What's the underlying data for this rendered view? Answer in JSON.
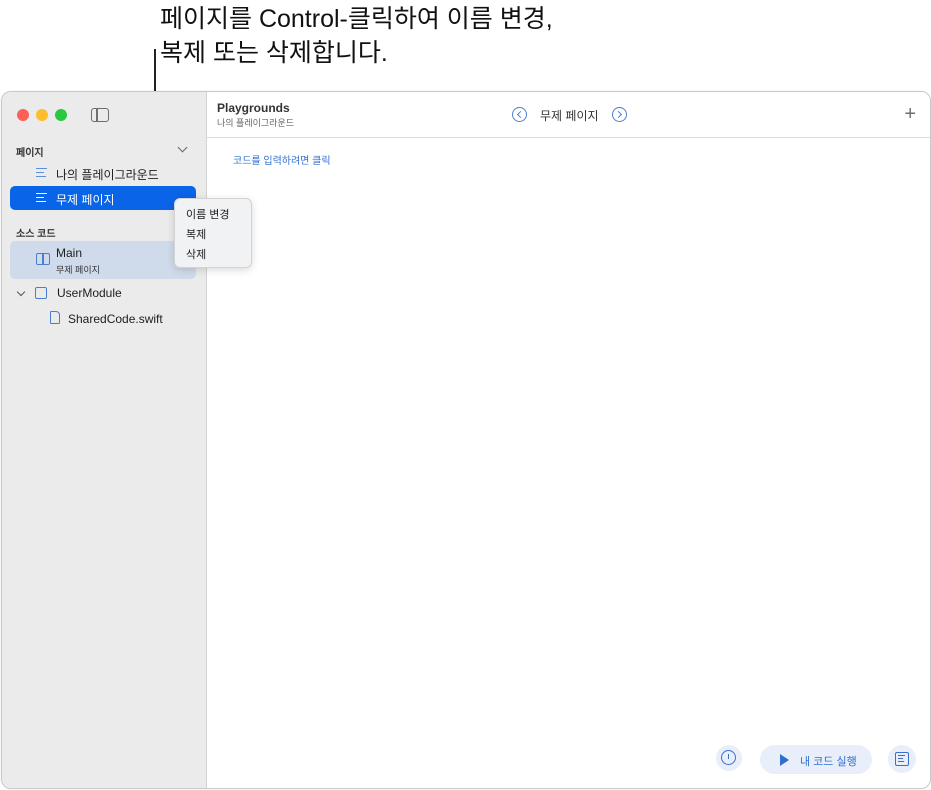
{
  "callout": {
    "text": "페이지를 Control-클릭하여 이름 변경,\n복제 또는 삭제합니다."
  },
  "sidebar": {
    "pages_header": "페이지",
    "pages": [
      {
        "label": "나의 플레이그라운드",
        "selected": false
      },
      {
        "label": "무제 페이지",
        "selected": true
      }
    ],
    "source_header": "소스 코드",
    "main": {
      "label": "Main",
      "sub": "무제 페이지"
    },
    "module": {
      "label": "UserModule",
      "icon": "cube-icon"
    },
    "file": {
      "label": "SharedCode.swift",
      "icon": "document-icon"
    }
  },
  "context_menu": {
    "items": [
      "이름 변경",
      "복제",
      "삭제"
    ]
  },
  "toolbar": {
    "title": "Playgrounds",
    "subtitle": "나의 플레이그라운드",
    "page_title": "무제 페이지"
  },
  "editor": {
    "hint": "코드를 입력하려면 클릭"
  },
  "bottom_bar": {
    "run_label": "내 코드 실행"
  },
  "colors": {
    "accent": "#0a64e8",
    "link": "#2f6fd0",
    "sidebar_bg": "#ebebeb"
  }
}
